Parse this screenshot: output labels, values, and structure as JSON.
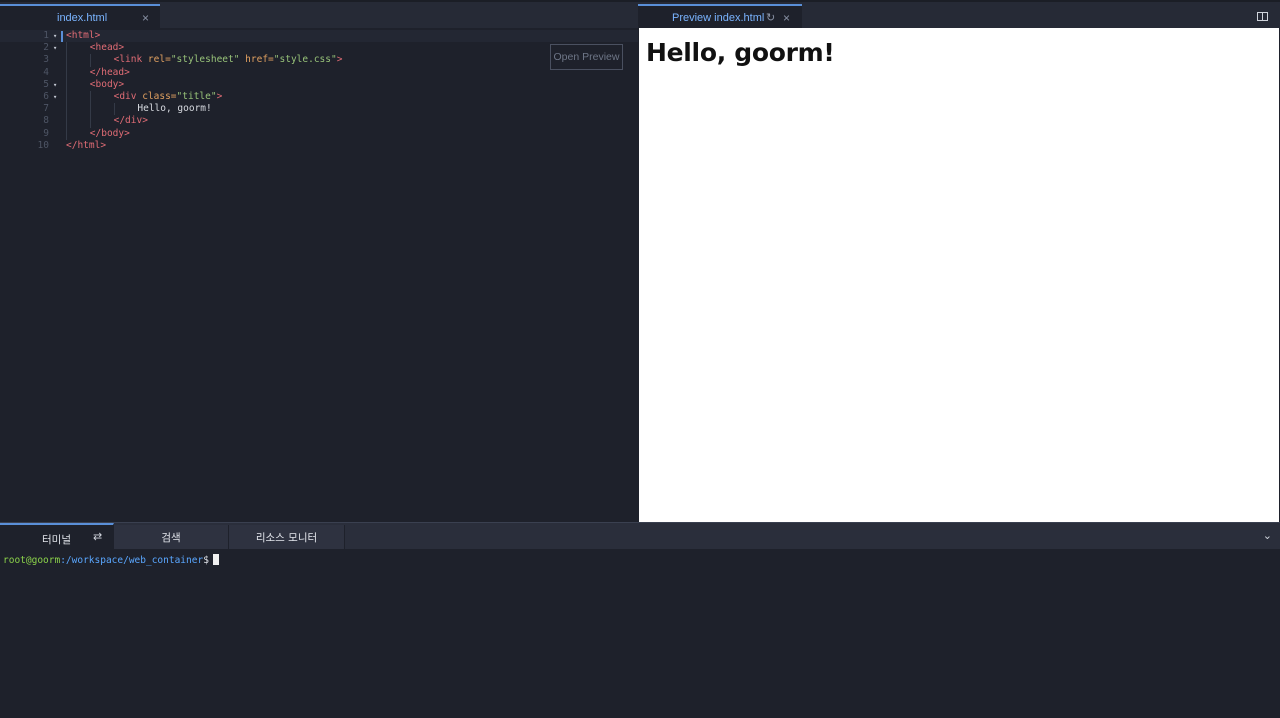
{
  "editor": {
    "tab": {
      "label": "index.html",
      "close": "×"
    },
    "open_preview_label": "Open Preview",
    "lines": [
      {
        "n": "1",
        "fold": "▾",
        "tokens": [
          [
            "tag",
            "<html>"
          ]
        ]
      },
      {
        "n": "2",
        "fold": "▾",
        "tokens": [
          [
            "tag",
            "<head>"
          ]
        ]
      },
      {
        "n": "3",
        "fold": "",
        "tokens": [
          [
            "tag",
            "<link "
          ],
          [
            "attr",
            "rel="
          ],
          [
            "str",
            "\"stylesheet\""
          ],
          [
            "attr",
            " href="
          ],
          [
            "str",
            "\"style.css\""
          ],
          [
            "tag",
            ">"
          ]
        ]
      },
      {
        "n": "4",
        "fold": "",
        "tokens": [
          [
            "tag",
            "</head>"
          ]
        ]
      },
      {
        "n": "5",
        "fold": "▾",
        "tokens": [
          [
            "tag",
            "<body>"
          ]
        ]
      },
      {
        "n": "6",
        "fold": "▾",
        "tokens": [
          [
            "tag",
            "<div "
          ],
          [
            "attr",
            "class="
          ],
          [
            "str",
            "\"title\""
          ],
          [
            "tag",
            ">"
          ]
        ]
      },
      {
        "n": "7",
        "fold": "",
        "tokens": [
          [
            "txt",
            "Hello, goorm!"
          ]
        ]
      },
      {
        "n": "8",
        "fold": "",
        "tokens": [
          [
            "tag",
            "</div>"
          ]
        ]
      },
      {
        "n": "9",
        "fold": "",
        "tokens": [
          [
            "tag",
            "</body>"
          ]
        ]
      },
      {
        "n": "10",
        "fold": "",
        "tokens": [
          [
            "tag",
            "</html>"
          ]
        ]
      }
    ]
  },
  "preview": {
    "tab": {
      "label": "Preview index.html",
      "refresh": "↻",
      "close": "×"
    },
    "heading": "Hello, goorm!"
  },
  "panel": {
    "tabs": {
      "terminal": "터미널",
      "search": "검색",
      "monitor": "리소스 모니터"
    },
    "sync": "⇄",
    "collapse": "⌄"
  },
  "terminal": {
    "user": "root@goorm",
    "path": ":/workspace/web_container",
    "sign": "$"
  },
  "colors": {
    "background": "#1e212b",
    "accent": "#5a8fd8",
    "tag": "#e06c75",
    "attribute": "#e0a060",
    "string": "#98c379",
    "prompt_user": "#8bd24a",
    "prompt_path": "#5aa7ff"
  },
  "icons": [
    "close-icon",
    "refresh-icon",
    "split-view-icon",
    "sync-icon",
    "chevron-down-icon",
    "fold-arrow-icon"
  ]
}
